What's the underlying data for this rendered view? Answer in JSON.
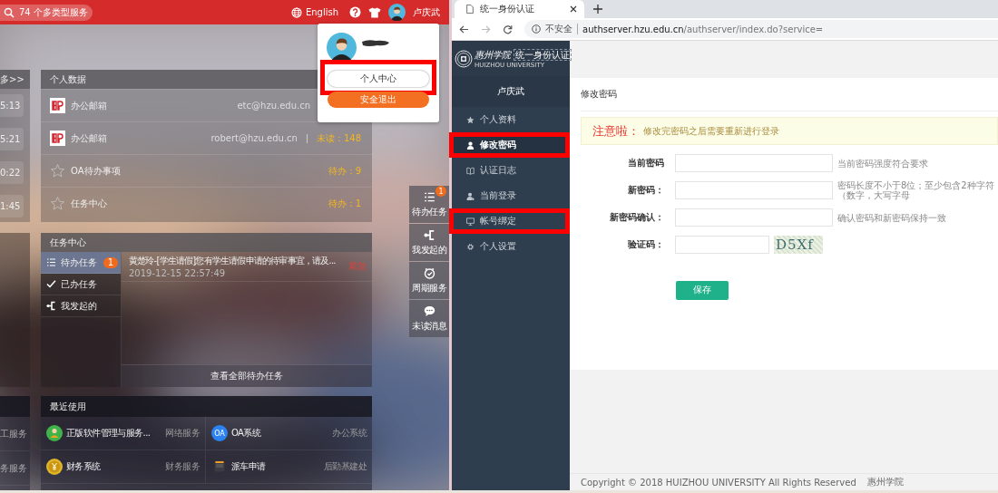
{
  "left_screen": {
    "header": {
      "search": {
        "placeholder": "74 个多类型服务"
      },
      "language": "English",
      "user_name": "卢庆武"
    },
    "user_menu": {
      "buttons": [
        {
          "kind": "profile",
          "label": "个人中心",
          "highlighted": true
        },
        {
          "kind": "logout",
          "label": "安全退出",
          "highlighted": false
        }
      ]
    },
    "side_column": {
      "more_link": "多>>",
      "times": [
        "5:13",
        "5:21",
        "0:22",
        "1:45"
      ],
      "services": [
        "工服务",
        "务服务"
      ]
    },
    "personal_data": {
      "title": "个人数据",
      "rows": [
        {
          "kind": "mail",
          "name": "办公邮箱",
          "account": "etc@hzu.edu.cn"
        },
        {
          "kind": "mail",
          "name": "办公邮箱",
          "account": "robert@hzu.edu.cn",
          "count": "未读：148"
        },
        {
          "kind": "star",
          "name": "OA待办事项",
          "count": "待办：9"
        },
        {
          "kind": "star",
          "name": "任务中心",
          "count": "待办：1"
        }
      ]
    },
    "quick_toolbar": [
      {
        "kind": "list",
        "label": "待办任务",
        "badge": "1"
      },
      {
        "kind": "branch",
        "label": "我发起的"
      },
      {
        "kind": "clock",
        "label": "周期服务"
      },
      {
        "kind": "chat",
        "label": "未读消息"
      }
    ],
    "task_center": {
      "title": "任务中心",
      "tabs": [
        {
          "kind": "list",
          "label": "待办任务",
          "badge": "1",
          "selected": true
        },
        {
          "kind": "check",
          "label": "已办任务",
          "selected": false
        },
        {
          "kind": "branch",
          "label": "我发起的",
          "selected": false
        }
      ],
      "tasks": [
        {
          "title": "黄楚玲-[学生请假]您有学生请假申请的待审事宜，请及...",
          "time": "2019-12-15 22:57:49",
          "priority": "紧急"
        }
      ],
      "footer_link": "查看全部待办任务"
    },
    "recent": {
      "title": "最近使用",
      "items": [
        {
          "kind": "software",
          "name": "正版软件管理与服务...",
          "category": "网络服务"
        },
        {
          "kind": "oa",
          "icon_text": "OA",
          "name": "OA系统",
          "category": "办公系统"
        },
        {
          "kind": "finance",
          "name": "财务系统",
          "category": "财务服务"
        },
        {
          "kind": "car",
          "name": "派车申请",
          "category": "后勤基建处"
        }
      ]
    }
  },
  "right_screen": {
    "browser": {
      "tab_title": "统一身份认证",
      "security": "不安全",
      "url_host": "authserver.hzu.edu.cn",
      "url_path": "/authserver/index.do?service="
    },
    "logo": {
      "name": "惠州学院",
      "subtitle": "HUIZHOU UNIVERSITY",
      "badge": "统一身份认证"
    },
    "user_name": "卢庆武",
    "menu": [
      {
        "kind": "star",
        "label": "个人资料",
        "selected": false,
        "highlighted": false
      },
      {
        "kind": "user",
        "label": "修改密码",
        "selected": true,
        "highlighted": true
      },
      {
        "kind": "book",
        "label": "认证日志",
        "selected": false,
        "highlighted": false
      },
      {
        "kind": "login",
        "label": "当前登录",
        "selected": false,
        "highlighted": false
      },
      {
        "kind": "monitor",
        "label": "帐号绑定",
        "selected": false,
        "highlighted": true
      },
      {
        "kind": "gear",
        "label": "个人设置",
        "selected": false,
        "highlighted": false
      }
    ],
    "page_title": "修改密码",
    "notice": {
      "title": "注意啦：",
      "text": "修改完密码之后需要重新进行登录"
    },
    "fields": [
      {
        "kind": "text",
        "label": "当前密码",
        "hint": "当前密码强度符合要求"
      },
      {
        "kind": "text",
        "label": "新密码：",
        "hint": "密码长度不小于8位；至少包含2种字符（数字，大写字母"
      },
      {
        "kind": "text",
        "label": "新密码确认：",
        "hint": "确认密码和新密码保持一致"
      },
      {
        "kind": "captcha",
        "label": "验证码：",
        "captcha": "D5Xf"
      }
    ],
    "save_button": "保存",
    "footer": {
      "copyright": "Copyright © 2018 HUIZHOU UNIVERSITY All Rights Reserved",
      "school": "惠州学院"
    }
  }
}
